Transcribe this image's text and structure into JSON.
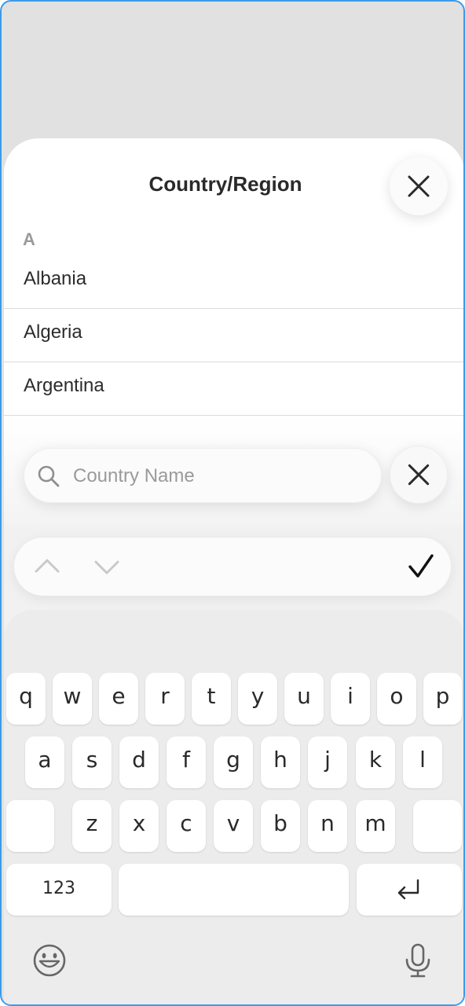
{
  "sheet": {
    "title": "Country/Region",
    "section_letter": "A",
    "countries": [
      "Albania",
      "Algeria",
      "Argentina"
    ]
  },
  "search": {
    "placeholder": "Country Name",
    "value": ""
  },
  "toolbar": {
    "prev_icon": "chevron-up-icon",
    "next_icon": "chevron-down-icon",
    "done_icon": "checkmark-icon"
  },
  "keyboard": {
    "row1": [
      "q",
      "w",
      "e",
      "r",
      "t",
      "y",
      "u",
      "i",
      "o",
      "p"
    ],
    "row2": [
      "a",
      "s",
      "d",
      "f",
      "g",
      "h",
      "j",
      "k",
      "l"
    ],
    "row3": [
      "z",
      "x",
      "c",
      "v",
      "b",
      "n",
      "m"
    ],
    "numbers_label": "123",
    "return_icon": "return-icon",
    "emoji_icon": "emoji-icon",
    "mic_icon": "microphone-icon"
  },
  "colors": {
    "accent_border": "#3b9bea",
    "text": "#2a2a2a",
    "muted": "#9a9a9a"
  }
}
